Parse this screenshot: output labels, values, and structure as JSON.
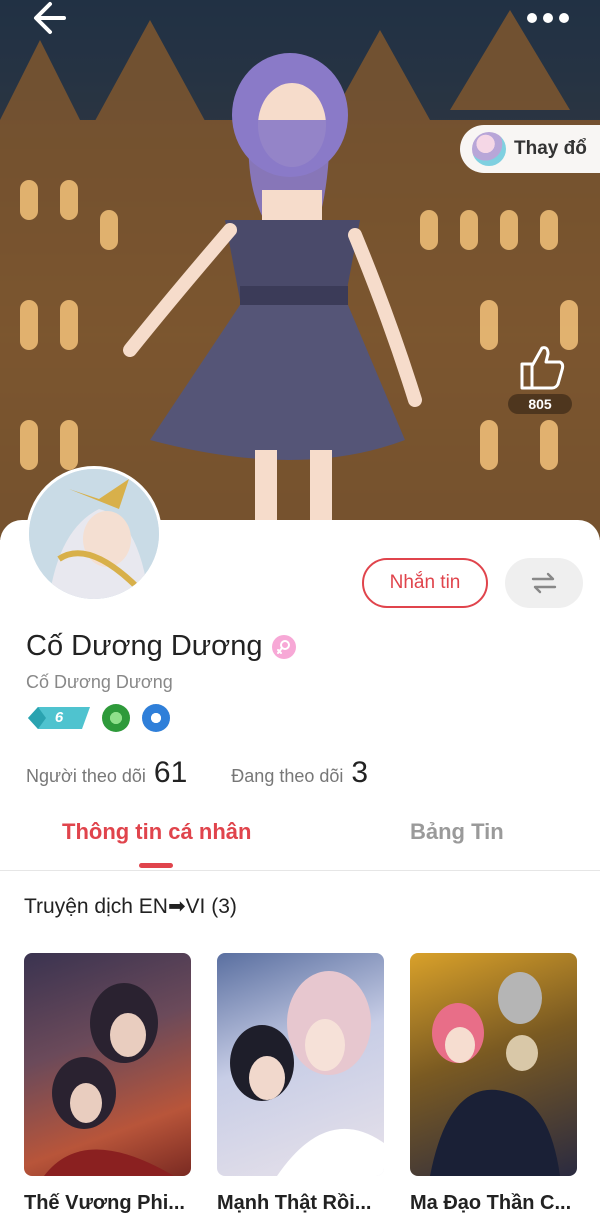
{
  "header": {
    "back_icon": "arrow-left-icon",
    "more_icon": "more-horizontal-icon",
    "change_outfit_label": "Thay đổ",
    "like_icon": "thumbs-up-icon",
    "like_count": "805"
  },
  "profile": {
    "display_name": "Cố Dương Dương",
    "username": "Cố Dương Dương",
    "gender_icon": "female-icon",
    "level": "6",
    "message_button": "Nhắn tin",
    "swap_icon": "swap-arrows-icon",
    "followers_label": "Người theo dõi",
    "followers_count": "61",
    "following_label": "Đang theo dõi",
    "following_count": "3"
  },
  "tabs": [
    {
      "label": "Thông tin cá nhân",
      "active": true
    },
    {
      "label": "Bảng Tin",
      "active": false
    }
  ],
  "section": {
    "title": "Truyện dịch EN➡VI (3)",
    "items": [
      {
        "title": "Thế Vương Phi..."
      },
      {
        "title": "Mạnh Thật Rồi..."
      },
      {
        "title": "Ma Đạo Thần C..."
      }
    ]
  },
  "colors": {
    "accent": "#e0444c",
    "muted": "#9a9a9a"
  }
}
